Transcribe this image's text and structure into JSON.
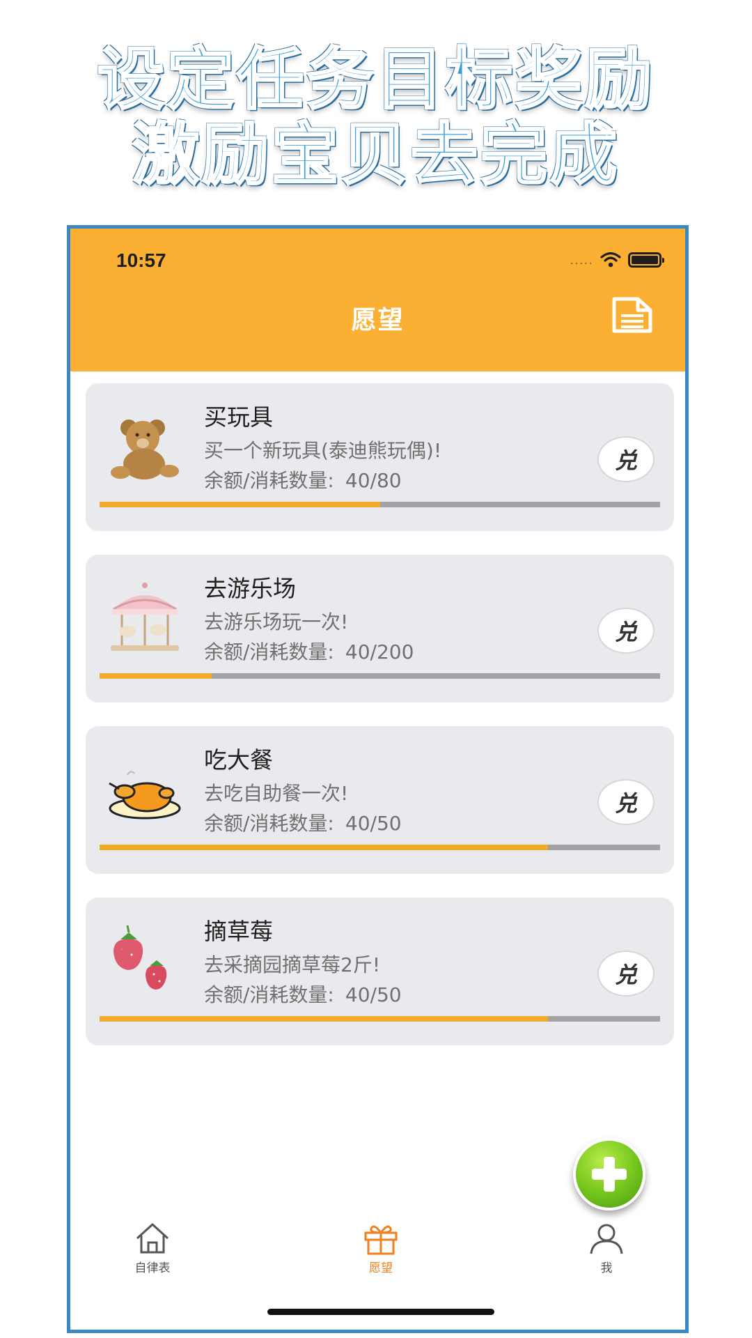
{
  "promo": {
    "line1": "设定任务目标奖励",
    "line2": "激励宝贝去完成"
  },
  "status_bar": {
    "time": "10:57",
    "signal": "....."
  },
  "nav": {
    "title": "愿望",
    "right_icon": "document-icon"
  },
  "wishes": [
    {
      "title": "买玩具",
      "description": "买一个新玩具(泰迪熊玩偶)!",
      "balance_label": "余额/消耗数量:",
      "balance_value": "40/80",
      "progress": 0.5,
      "icon": "teddy-bear-icon",
      "redeem_label": "兑"
    },
    {
      "title": "去游乐场",
      "description": "去游乐场玩一次!",
      "balance_label": "余额/消耗数量:",
      "balance_value": "40/200",
      "progress": 0.2,
      "icon": "carousel-icon",
      "redeem_label": "兑"
    },
    {
      "title": "吃大餐",
      "description": "去吃自助餐一次!",
      "balance_label": "余额/消耗数量:",
      "balance_value": "40/50",
      "progress": 0.8,
      "icon": "roast-chicken-icon",
      "redeem_label": "兑"
    },
    {
      "title": "摘草莓",
      "description": "去采摘园摘草莓2斤!",
      "balance_label": "余额/消耗数量:",
      "balance_value": "40/50",
      "progress": 0.8,
      "icon": "strawberry-icon",
      "redeem_label": "兑"
    }
  ],
  "tabs": [
    {
      "label": "自律表",
      "icon": "home-icon",
      "active": false
    },
    {
      "label": "愿望",
      "icon": "gift-icon",
      "active": true
    },
    {
      "label": "我",
      "icon": "person-icon",
      "active": false
    }
  ],
  "colors": {
    "header": "#fbb034",
    "progress_fill": "#f2aa2a",
    "progress_track": "#a3a3a6",
    "active_tab": "#f07f1e",
    "frame": "#3c88c4",
    "promo_text": "#3f9ddd"
  }
}
